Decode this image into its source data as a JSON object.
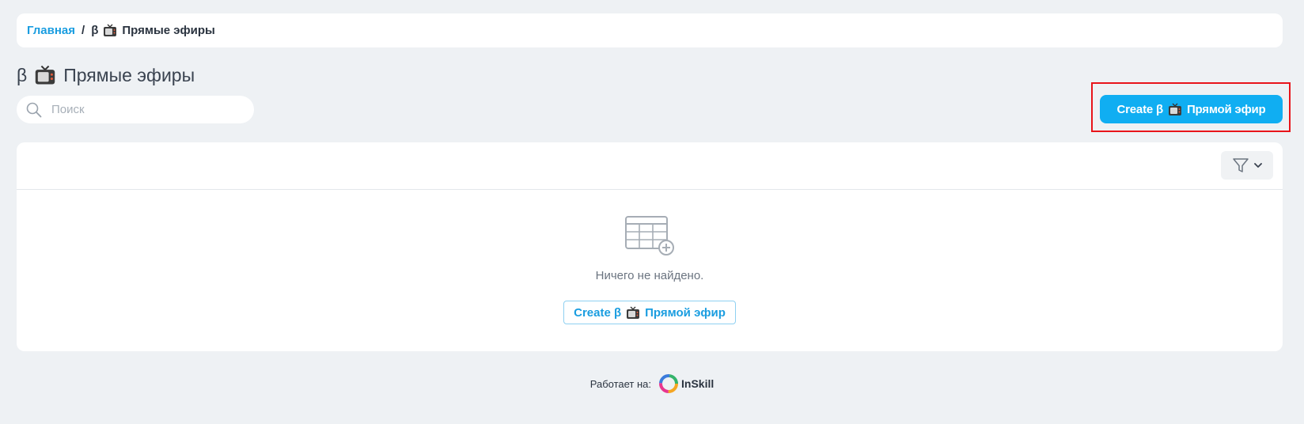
{
  "breadcrumb": {
    "home_label": "Главная",
    "separator": "/",
    "beta_symbol": "β",
    "current_label": "Прямые эфиры"
  },
  "page": {
    "beta_symbol": "β",
    "title": "Прямые эфиры"
  },
  "search": {
    "placeholder": "Поиск",
    "value": ""
  },
  "toolbar": {
    "create_prefix": "Create β",
    "create_suffix": "Прямой эфир"
  },
  "panel": {
    "empty_text": "Ничего не найдено.",
    "create_prefix": "Create β",
    "create_suffix": "Прямой эфир"
  },
  "footer": {
    "powered_label": "Работает на:",
    "brand_name": "InSkill"
  },
  "colors": {
    "accent": "#10aef2",
    "link": "#1a9de0",
    "highlight": "#e8141a",
    "background": "#eef1f4"
  },
  "icons": {
    "tv": "tv-icon",
    "search": "search-icon",
    "filter": "filter-icon",
    "chevron": "chevron-down-icon",
    "empty_table": "table-add-icon",
    "brand_logo": "inskill-logo-icon"
  }
}
